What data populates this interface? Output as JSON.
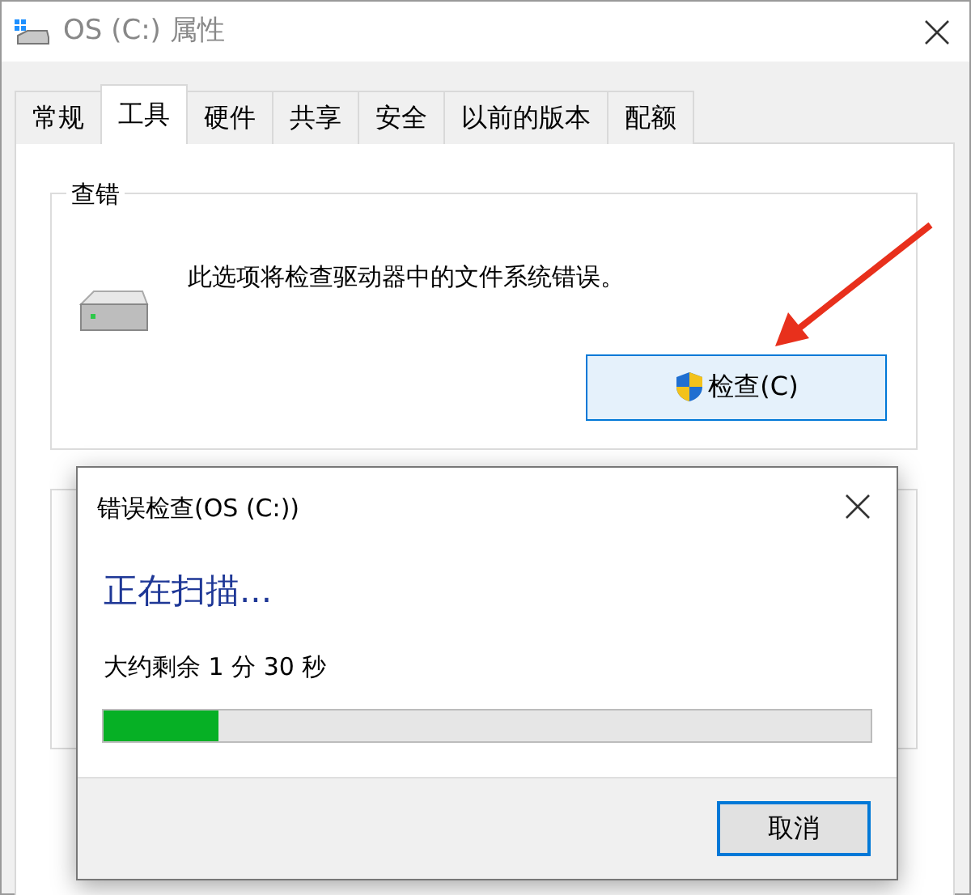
{
  "window": {
    "title": "OS (C:) 属性"
  },
  "tabs": [
    {
      "label": "常规",
      "selected": false
    },
    {
      "label": "工具",
      "selected": true
    },
    {
      "label": "硬件",
      "selected": false
    },
    {
      "label": "共享",
      "selected": false
    },
    {
      "label": "安全",
      "selected": false
    },
    {
      "label": "以前的版本",
      "selected": false
    },
    {
      "label": "配额",
      "selected": false
    }
  ],
  "error_checking": {
    "title": "查错",
    "description": "此选项将检查驱动器中的文件系统错误。",
    "button": "检查(C)"
  },
  "dialog": {
    "title": "错误检查(OS (C:))",
    "heading": "正在扫描...",
    "remaining": "大约剩余 1 分 30 秒",
    "progress": {
      "level": 0.15
    },
    "cancel_button": "取消"
  }
}
